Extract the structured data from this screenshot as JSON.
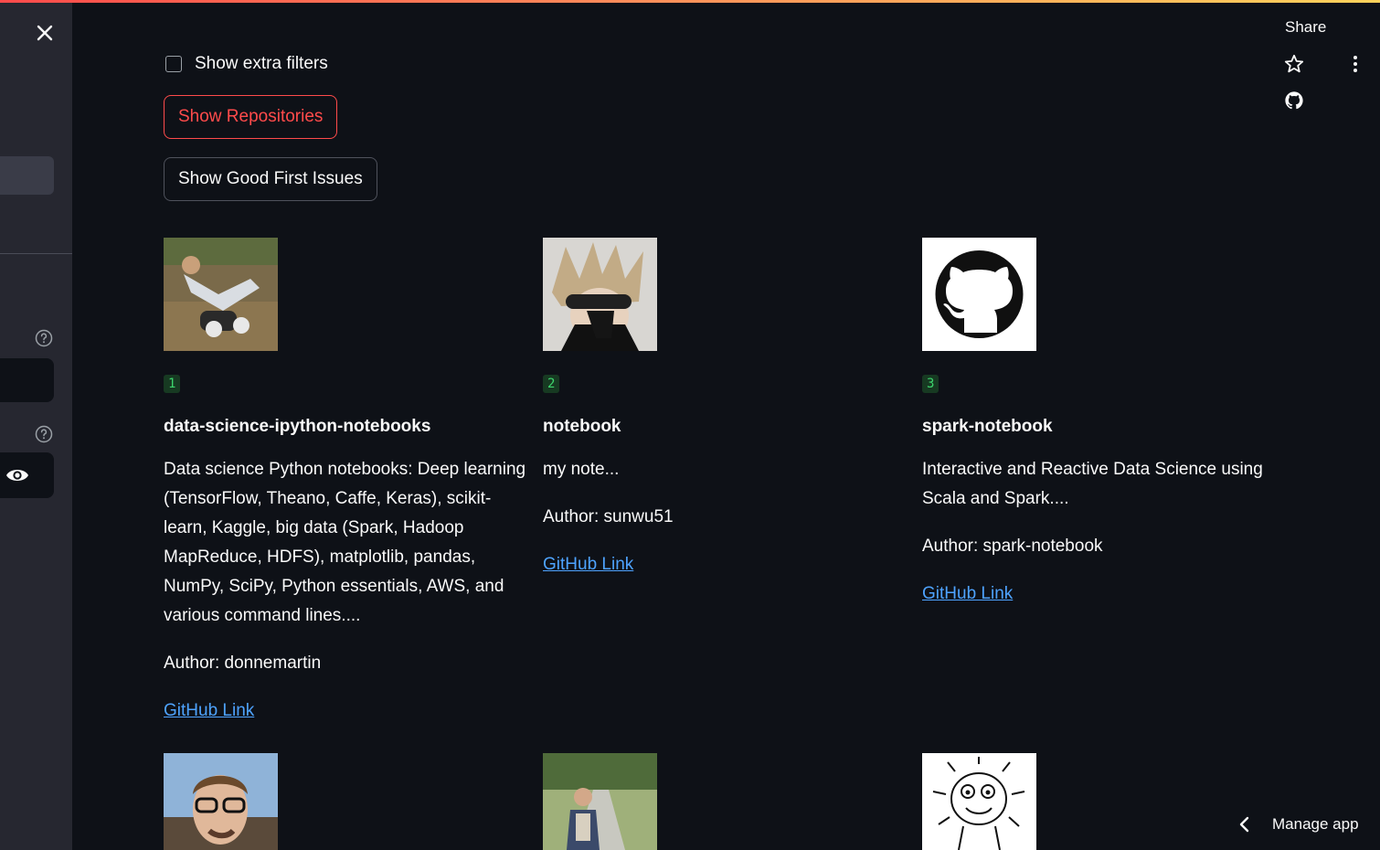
{
  "sidebar": {
    "close_icon": "close-icon",
    "help_icon": "question-circle-icon",
    "password_toggle_icon": "eye-icon"
  },
  "filters": {
    "extra_filters_label": "Show extra filters",
    "extra_filters_checked": false
  },
  "buttons": {
    "show_repositories": "Show Repositories",
    "show_good_first_issues": "Show Good First Issues"
  },
  "header": {
    "share_label": "Share",
    "icons": [
      "star-icon",
      "more-vertical-icon",
      "github-icon"
    ]
  },
  "repos": [
    {
      "rank": "1",
      "name": "data-science-ipython-notebooks",
      "description": "Data science Python notebooks: Deep learning (TensorFlow, Theano, Caffe, Keras), scikit-learn, Kaggle, big data (Spark, Hadoop MapReduce, HDFS), matplotlib, pandas, NumPy, SciPy, Python essentials, AWS, and various command lines....",
      "author": "Author: donnemartin",
      "link_text": "GitHub Link"
    },
    {
      "rank": "2",
      "name": "notebook",
      "description": "my note...",
      "author": "Author: sunwu51",
      "link_text": "GitHub Link"
    },
    {
      "rank": "3",
      "name": "spark-notebook",
      "description": "Interactive and Reactive Data Science using Scala and Spark....",
      "author": "Author: spark-notebook",
      "link_text": "GitHub Link"
    }
  ],
  "footer": {
    "manage_app_label": "Manage app"
  },
  "colors": {
    "background": "#0e1117",
    "sidebar": "#262730",
    "accent": "#ff4b4b",
    "link": "#4ea3ff",
    "badge_text": "#3dd56d"
  }
}
